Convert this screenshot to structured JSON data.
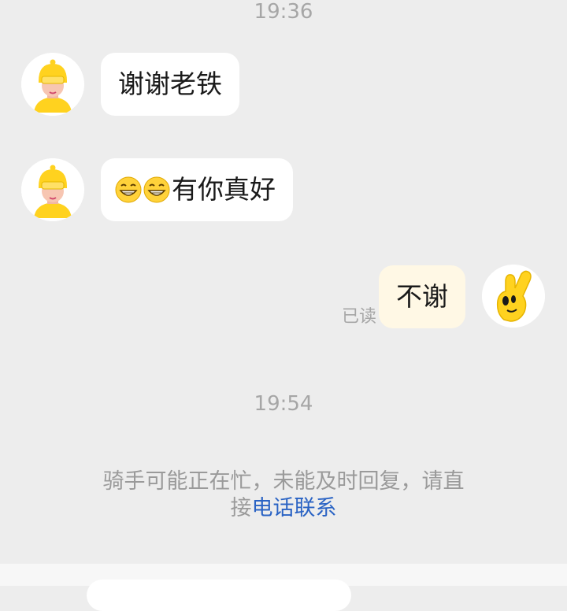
{
  "timestamps": [
    "19:36",
    "19:54"
  ],
  "messages": [
    {
      "side": "in",
      "text": "谢谢老铁",
      "emoji": []
    },
    {
      "side": "in",
      "text": "有你真好",
      "emoji": [
        "grin-emoji",
        "grin-emoji"
      ]
    },
    {
      "side": "out",
      "text": "不谢",
      "status": "已读"
    }
  ],
  "system_notice": {
    "line1": "骑手可能正在忙，未能及时回复，请直",
    "line2_prefix": "接",
    "link_text": "电话联系"
  },
  "colors": {
    "background": "#ededed",
    "incoming_bubble": "#ffffff",
    "outgoing_bubble": "#fff8e5",
    "link": "#2a63c4",
    "brand_yellow": "#ffd21f"
  }
}
